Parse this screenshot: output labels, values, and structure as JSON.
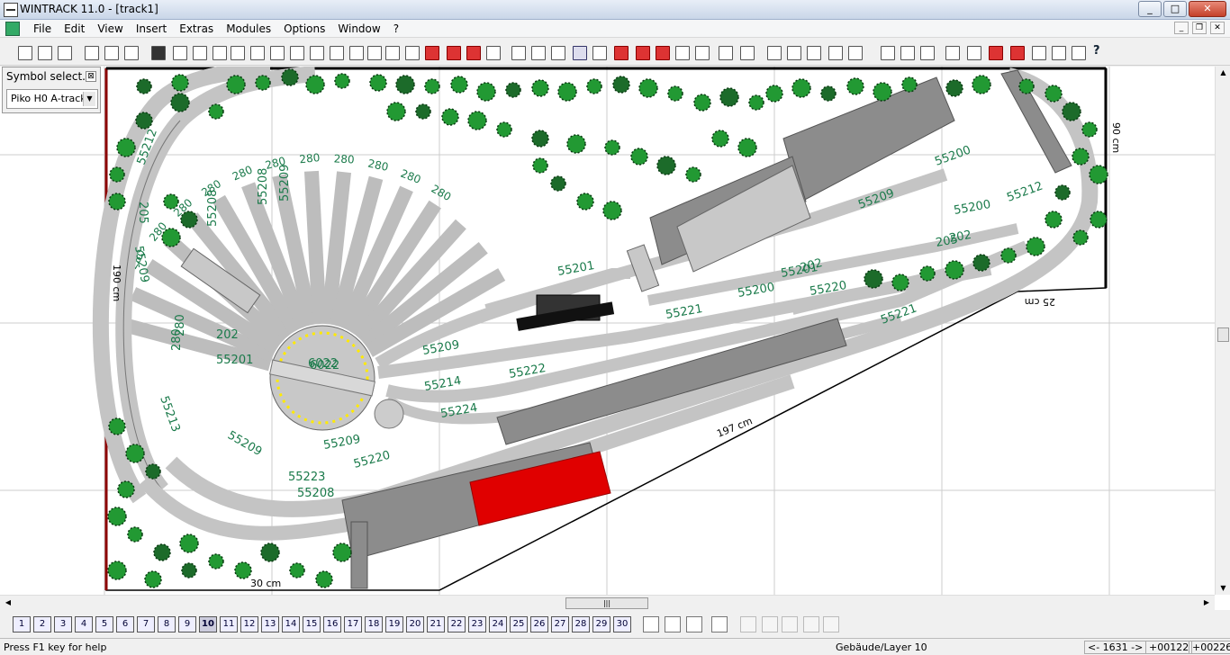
{
  "window": {
    "title": "WINTRACK 11.0 - [track1]",
    "minimize": "_",
    "maximize": "□",
    "close": "✕"
  },
  "menu": [
    "File",
    "Edit",
    "View",
    "Insert",
    "Extras",
    "Modules",
    "Options",
    "Window",
    "?"
  ],
  "toolbar": {
    "help": "?"
  },
  "symbol_panel": {
    "title": "Symbol select...",
    "close": "⊠",
    "selected": "Piko H0 A-track"
  },
  "layout": {
    "dimension_labels": [
      "190 cm",
      "197 cm",
      "90 cm",
      "25 cm",
      "30 cm"
    ],
    "track_labels": [
      "55212",
      "205",
      "55209",
      "280",
      "55213",
      "55223",
      "55208",
      "55209",
      "202",
      "55201",
      "55209",
      "55214",
      "55224",
      "55220",
      "55209",
      "55222",
      "55201",
      "55221",
      "55200",
      "55201",
      "202",
      "205",
      "55209",
      "202",
      "55212",
      "55221",
      "55200",
      "55220",
      "6022",
      "55200",
      "55208",
      "55208",
      "55209",
      "280"
    ],
    "turntable_label": "6022",
    "roundhouse_tracks": [
      "280",
      "280",
      "280",
      "280",
      "280",
      "280",
      "280",
      "280",
      "280",
      "280",
      "280"
    ]
  },
  "layers": [
    "1",
    "2",
    "3",
    "4",
    "5",
    "6",
    "7",
    "8",
    "9",
    "10",
    "11",
    "12",
    "13",
    "14",
    "15",
    "16",
    "17",
    "18",
    "19",
    "20",
    "21",
    "22",
    "23",
    "24",
    "25",
    "26",
    "27",
    "28",
    "29",
    "30"
  ],
  "active_layer": "10",
  "status": {
    "help": "Press F1 key for help",
    "layer": "Gebäude/Layer 10",
    "nav": "<- 1631 ->",
    "x": "+00122",
    "y": "+00226"
  },
  "colors": {
    "track": "#c8c8c8",
    "tree": "#1f8a2e",
    "building_red": "#e00000",
    "building_grey": "#8c8c8c",
    "label": "#1a7a4a"
  }
}
